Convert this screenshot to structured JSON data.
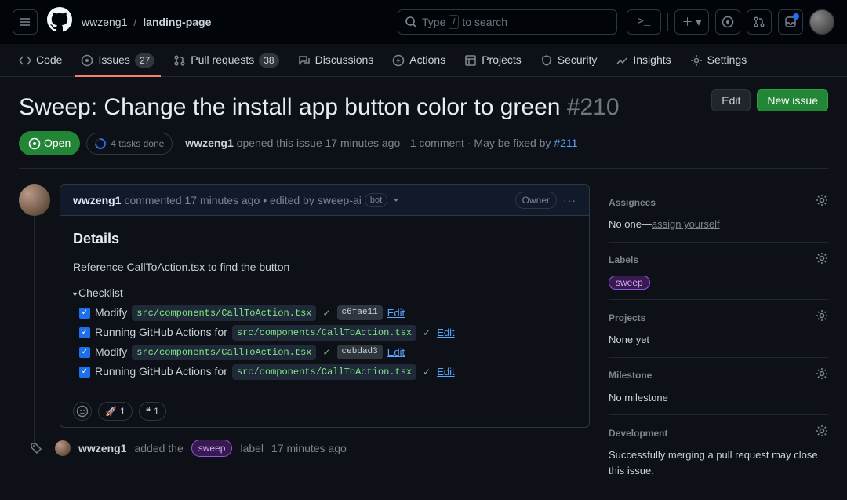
{
  "header": {
    "owner": "wwzeng1",
    "repo": "landing-page",
    "search_placeholder": "Type",
    "search_placeholder_suffix": "to search"
  },
  "repo_nav": {
    "code": "Code",
    "issues": "Issues",
    "issues_count": "27",
    "prs": "Pull requests",
    "prs_count": "38",
    "discussions": "Discussions",
    "actions": "Actions",
    "projects": "Projects",
    "security": "Security",
    "insights": "Insights",
    "settings": "Settings"
  },
  "issue": {
    "title": "Sweep: Change the install app button color to green",
    "number": "#210",
    "edit_btn": "Edit",
    "new_issue_btn": "New issue",
    "state": "Open",
    "tasks": "4 tasks done",
    "author": "wwzeng1",
    "opened": "opened this issue 17 minutes ago",
    "dot": "·",
    "comments": "1 comment",
    "maybe_fixed_by": "May be fixed by",
    "pr_link": "#211"
  },
  "comment": {
    "author": "wwzeng1",
    "commented": "commented 17 minutes ago",
    "edited_prefix": "• edited by",
    "editor": "sweep-ai",
    "bot_label": "bot",
    "owner_badge": "Owner",
    "details_heading": "Details",
    "body_text": "Reference CallToAction.tsx to find the button",
    "checklist_title": "Checklist",
    "items": [
      {
        "label": "Modify",
        "file": "src/components/CallToAction.tsx",
        "check": true,
        "hash": "c6fae11",
        "edit": "Edit"
      },
      {
        "label": "Running GitHub Actions for",
        "file": "src/components/CallToAction.tsx",
        "check": true,
        "hash": "",
        "edit": "Edit"
      },
      {
        "label": "Modify",
        "file": "src/components/CallToAction.tsx",
        "check": true,
        "hash": "cebdad3",
        "edit": "Edit"
      },
      {
        "label": "Running GitHub Actions for",
        "file": "src/components/CallToAction.tsx",
        "check": true,
        "hash": "",
        "edit": "Edit"
      }
    ],
    "reactions": {
      "rocket": "🚀",
      "rocket_count": "1",
      "quote": "❝",
      "quote_count": "1"
    }
  },
  "event": {
    "author": "wwzeng1",
    "added_the": "added the",
    "label": "sweep",
    "label_word": "label",
    "ago": "17 minutes ago"
  },
  "sidebar": {
    "assignees_heading": "Assignees",
    "assignees_empty": "No one—",
    "assign_yourself": "assign yourself",
    "labels_heading": "Labels",
    "labels_value": "sweep",
    "projects_heading": "Projects",
    "projects_empty": "None yet",
    "milestone_heading": "Milestone",
    "milestone_empty": "No milestone",
    "development_heading": "Development",
    "development_text": "Successfully merging a pull request may close this issue."
  }
}
